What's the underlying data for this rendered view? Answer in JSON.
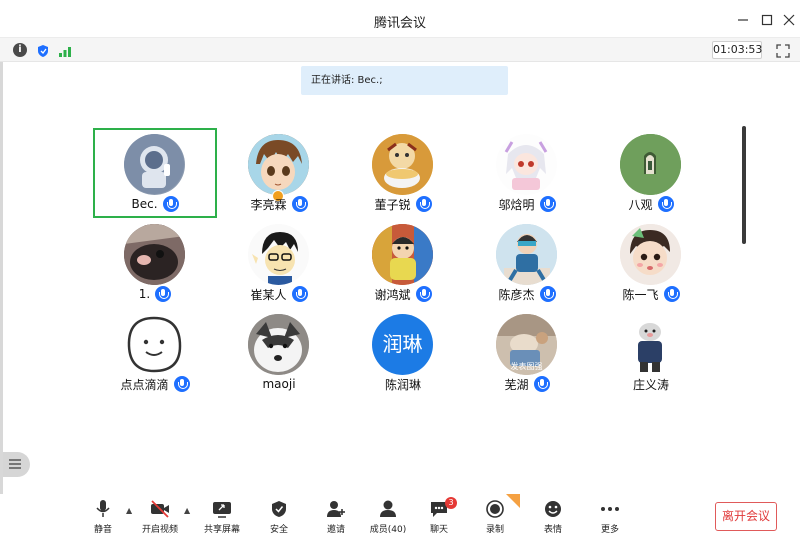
{
  "window": {
    "title": "腾讯会议",
    "controls": [
      "minimize-icon",
      "maximize-icon",
      "close-icon"
    ]
  },
  "status": {
    "icons": [
      "info-icon",
      "shield-icon",
      "signal-icon",
      "fullscreen-icon"
    ],
    "timer": "01:03:53"
  },
  "speaking": "正在讲话: Bec.;",
  "participants": [
    {
      "name": "Bec.",
      "avatar": "astronaut",
      "mic": true,
      "active": true
    },
    {
      "name": "李亮霖",
      "avatar": "anime-boy",
      "mic": true,
      "host": true
    },
    {
      "name": "董子锐",
      "avatar": "cartoon-eating",
      "mic": true
    },
    {
      "name": "邬焓明",
      "avatar": "anime-girl",
      "mic": true
    },
    {
      "name": "八观",
      "avatar": "green-arch",
      "mic": true
    },
    {
      "name": "1.",
      "avatar": "dark-photo",
      "mic": true
    },
    {
      "name": "崔某人",
      "avatar": "cartoon-glasses",
      "mic": true
    },
    {
      "name": "谢鸿斌",
      "avatar": "cartoon-colorful",
      "mic": true
    },
    {
      "name": "陈彦杰",
      "avatar": "cartoon-sitting",
      "mic": true
    },
    {
      "name": "陈一飞",
      "avatar": "baby-photo",
      "mic": true
    },
    {
      "name": "点点滴滴",
      "avatar": "smiley",
      "mic": true
    },
    {
      "name": "maoji",
      "avatar": "husky-photo",
      "mic": false
    },
    {
      "name": "陈润琳",
      "avatar": "text",
      "avatar_text": "润琳",
      "mic": false
    },
    {
      "name": "芜湖",
      "avatar": "meme-photo",
      "avatar_caption": "发表图强",
      "mic": true
    },
    {
      "name": "庄义涛",
      "avatar": "cartoon-pig",
      "mic": false
    }
  ],
  "toolbar": {
    "mute": "静音",
    "video": "开启视频",
    "share": "共享屏幕",
    "security": "安全",
    "invite": "邀请",
    "members": "成员(40)",
    "chat": "聊天",
    "chat_badge": "3",
    "record": "录制",
    "reaction": "表情",
    "more": "更多",
    "leave": "离开会议"
  },
  "colors": {
    "accent": "#1e6fff",
    "active_border": "#2db04a",
    "leave": "#e03b3b",
    "speaking_bg": "#dfeefb"
  }
}
